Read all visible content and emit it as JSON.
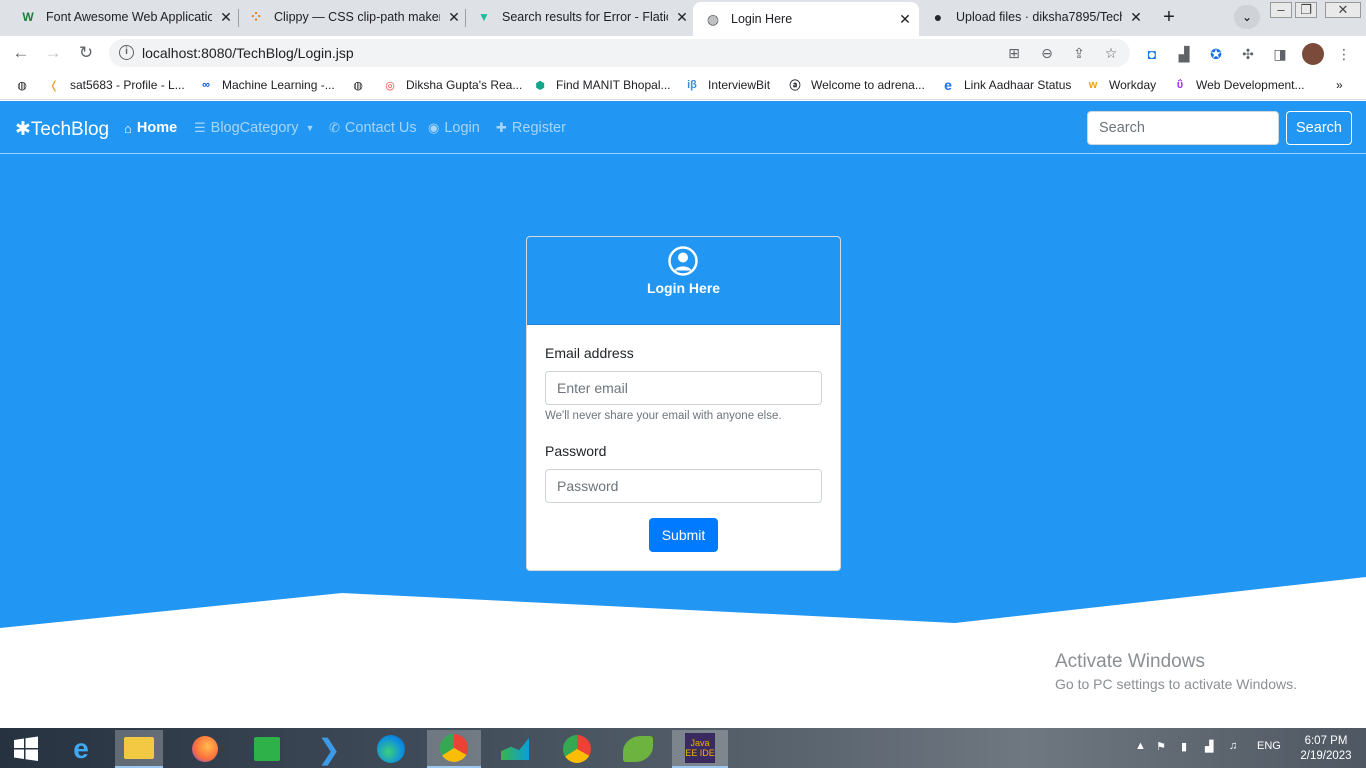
{
  "browser": {
    "tabs": [
      {
        "title": "Font Awesome Web Applicatio",
        "icon": "webflow-w-icon"
      },
      {
        "title": "Clippy — CSS clip-path maker",
        "icon": "clippy-icon"
      },
      {
        "title": "Search results for Error - Flatic",
        "icon": "flaticon-icon"
      },
      {
        "title": "Login Here",
        "icon": "globe-icon"
      },
      {
        "title": "Upload files · diksha7895/Tech",
        "icon": "github-icon"
      }
    ],
    "url": "localhost:8080/TechBlog/Login.jsp",
    "bookmarks": [
      {
        "label": "",
        "icon": "globe-icon"
      },
      {
        "label": "sat5683 - Profile - L...",
        "icon": "leetcode-icon"
      },
      {
        "label": "Machine Learning -...",
        "icon": "coursera-icon"
      },
      {
        "label": "Diksha Gupta's Rea...",
        "icon": "chrome-icon"
      },
      {
        "label": "Find MANIT Bhopal...",
        "icon": "hex-icon"
      },
      {
        "label": "InterviewBit",
        "icon": "interviewbit-icon"
      },
      {
        "label": "Welcome to adrena...",
        "icon": "amazon-icon"
      },
      {
        "label": "Link Aadhaar Status",
        "icon": "ie-icon"
      },
      {
        "label": "Workday",
        "icon": "workday-icon"
      },
      {
        "label": "Web Development...",
        "icon": "udemy-icon"
      }
    ]
  },
  "site": {
    "brand": "TechBlog",
    "nav": {
      "home": "Home",
      "category": "BlogCategory",
      "contact": "Contact Us",
      "login": "Login",
      "register": "Register"
    },
    "search_placeholder": "Search",
    "search_button": "Search"
  },
  "login": {
    "title": "Login Here",
    "email_label": "Email address",
    "email_placeholder": "Enter email",
    "email_help": "We'll never share your email with anyone else.",
    "password_label": "Password",
    "password_placeholder": "Password",
    "submit": "Submit"
  },
  "watermark": {
    "line1": "Activate Windows",
    "line2": "Go to PC settings to activate Windows."
  },
  "taskbar": {
    "lang": "ENG",
    "time": "6:07 PM",
    "date": "2/19/2023"
  },
  "colors": {
    "primary": "#2196f3",
    "button": "#007bff"
  }
}
